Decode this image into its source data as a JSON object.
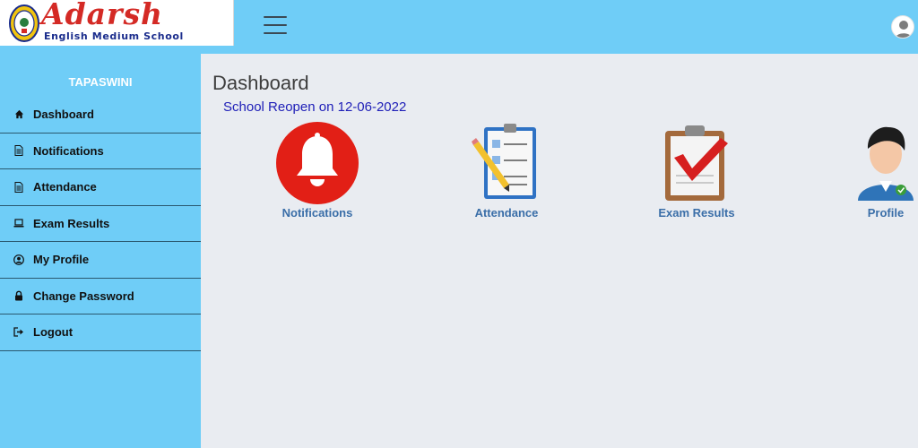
{
  "header": {
    "logo_title": "Adarsh",
    "logo_subtitle": "English Medium School"
  },
  "sidebar": {
    "user_name": "TAPASWINI",
    "items": [
      {
        "label": "Dashboard",
        "icon": "home-icon"
      },
      {
        "label": "Notifications",
        "icon": "document-icon"
      },
      {
        "label": "Attendance",
        "icon": "document-icon"
      },
      {
        "label": "Exam Results",
        "icon": "laptop-icon"
      },
      {
        "label": "My Profile",
        "icon": "user-circle-icon"
      },
      {
        "label": "Change Password",
        "icon": "lock-icon"
      },
      {
        "label": "Logout",
        "icon": "logout-icon"
      }
    ]
  },
  "main": {
    "title": "Dashboard",
    "announcement": "School Reopen on 12-06-2022",
    "tiles": [
      {
        "label": "Notifications",
        "icon": "bell-icon"
      },
      {
        "label": "Attendance",
        "icon": "clipboard-list-icon"
      },
      {
        "label": "Exam Results",
        "icon": "clipboard-check-icon"
      },
      {
        "label": "Profile",
        "icon": "profile-icon"
      }
    ]
  },
  "colors": {
    "primary": "#6fcdf7",
    "background": "#e9ecf1",
    "logo_red": "#d42a25",
    "logo_blue": "#1a2c8c",
    "announcement": "#2020b8",
    "tile_label": "#3a6ea8",
    "bell_red": "#e21f16"
  }
}
